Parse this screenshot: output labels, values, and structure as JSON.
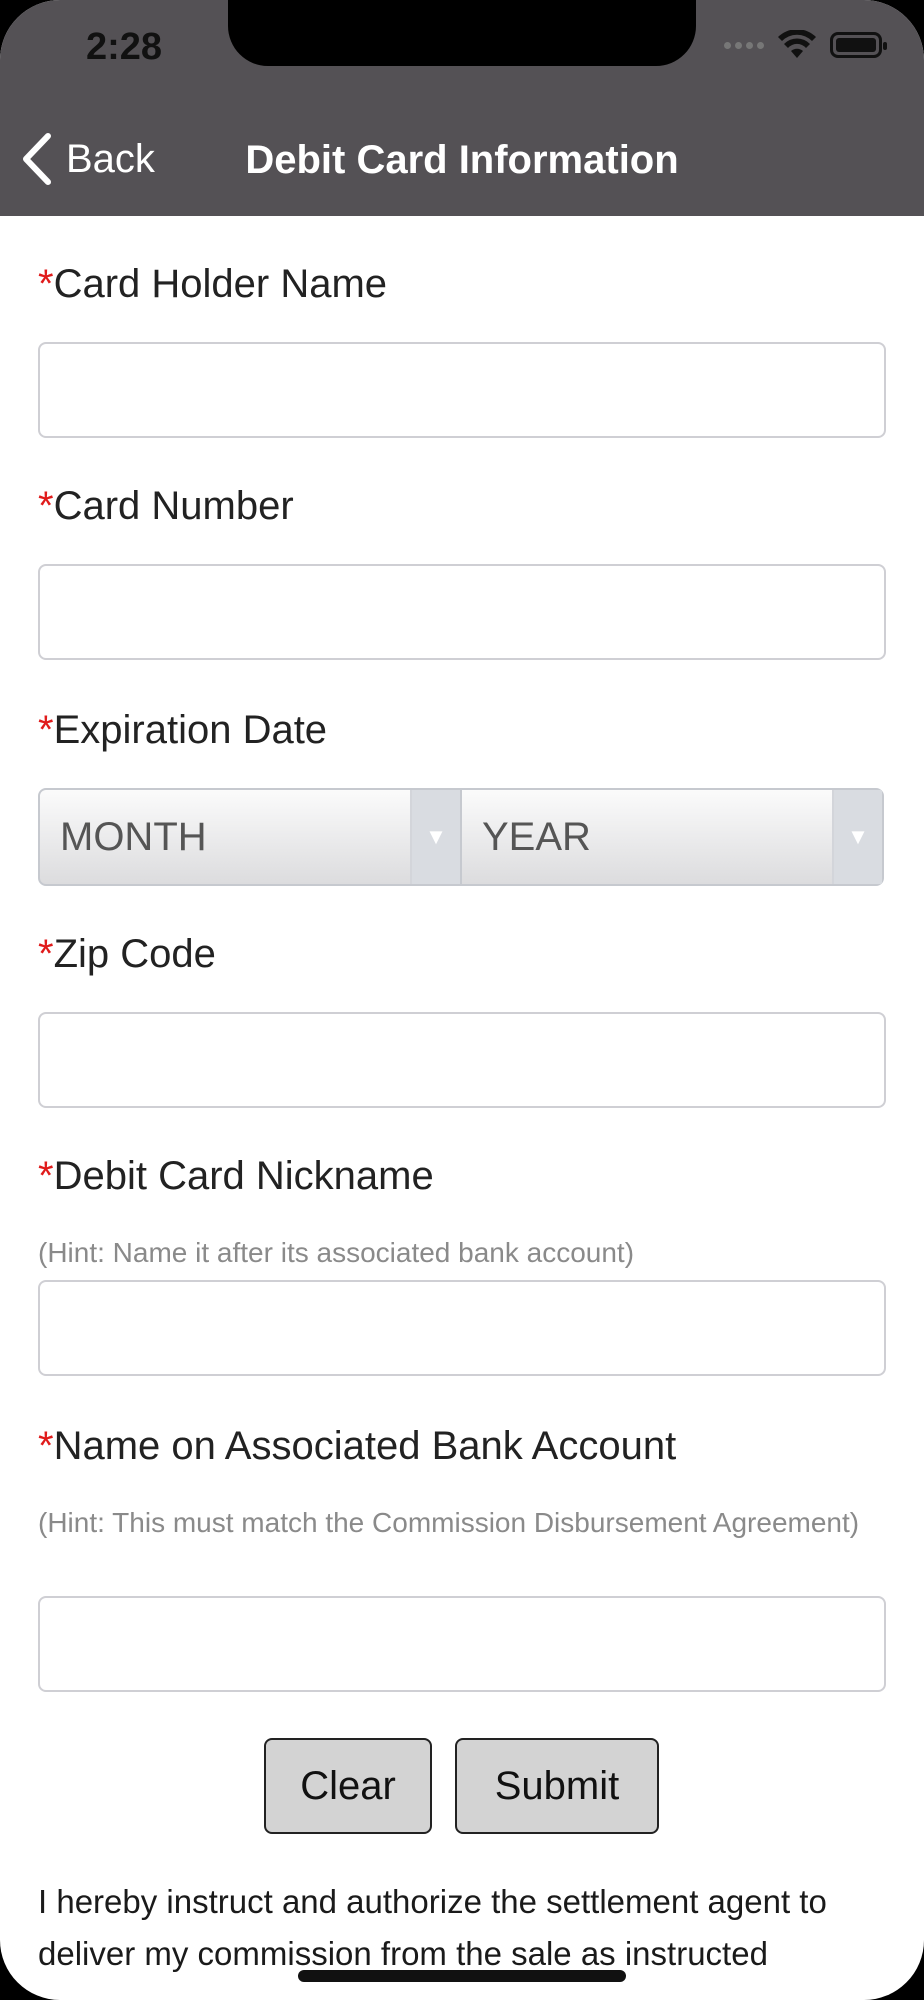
{
  "status_bar": {
    "time": "2:28"
  },
  "nav": {
    "back_label": "Back",
    "title": "Debit Card Information"
  },
  "form": {
    "required_mark": "*",
    "card_holder_label": "Card Holder Name",
    "card_number_label": "Card Number",
    "expiration_label": "Expiration Date",
    "month_value": "MONTH",
    "year_value": "YEAR",
    "zip_label": "Zip Code",
    "nickname_label": "Debit Card Nickname",
    "nickname_hint": "(Hint: Name it after its associated bank account)",
    "bank_name_label": "Name on Associated Bank Account",
    "bank_name_hint": "(Hint: This must match the Commission Disbursement Agreement)"
  },
  "buttons": {
    "clear_label": "Clear",
    "submit_label": "Submit"
  },
  "legal_text": "I hereby instruct and authorize the settlement agent to deliver my commission from the sale as instructed",
  "colors": {
    "nav_background": "#545155",
    "required_mark": "#e01b1b",
    "button_background": "#d3d3d3"
  },
  "icons": {
    "back": "chevron-left-icon",
    "wifi": "wifi-icon",
    "battery": "battery-icon",
    "signal": "signal-dots-icon",
    "dropdown": "chevron-down-icon"
  }
}
